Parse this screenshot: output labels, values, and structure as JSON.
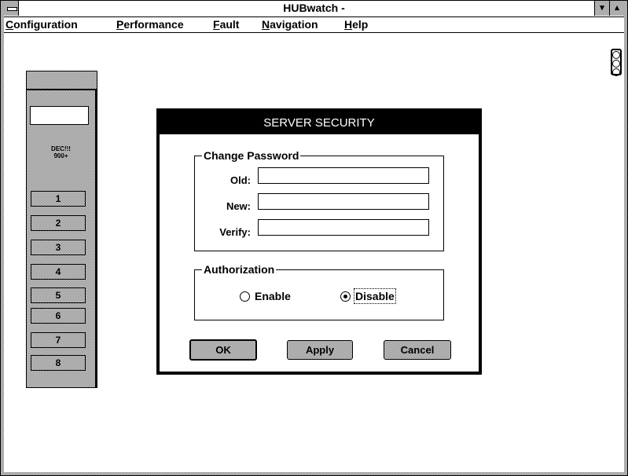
{
  "window": {
    "title": "HUBwatch -",
    "min_glyph": "▾",
    "max_glyph": "▴"
  },
  "menu": [
    {
      "label": "Configuration",
      "accel": "C",
      "rest": "onfiguration"
    },
    {
      "label": "Performance",
      "accel": "P",
      "rest": "erformance"
    },
    {
      "label": "Fault",
      "accel": "F",
      "rest": "ault"
    },
    {
      "label": "Navigation",
      "accel": "N",
      "rest": "avigation"
    },
    {
      "label": "Help",
      "accel": "H",
      "rest": "elp"
    }
  ],
  "hub": {
    "label_line1": "DEC!!!",
    "label_line2": "900+",
    "ports": [
      "1",
      "2",
      "3",
      "4",
      "5",
      "6",
      "7",
      "8"
    ]
  },
  "dialog": {
    "title": "SERVER SECURITY",
    "password_group": "Change Password",
    "old_label": "Old:",
    "new_label": "New:",
    "verify_label": "Verify:",
    "old_value": "",
    "new_value": "",
    "verify_value": "",
    "auth_group": "Authorization",
    "enable_label": "Enable",
    "disable_label": "Disable",
    "selected": "Disable",
    "ok_label": "OK",
    "apply_label": "Apply",
    "cancel_label": "Cancel"
  }
}
